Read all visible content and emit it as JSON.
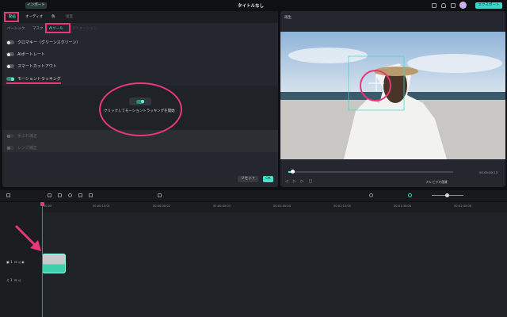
{
  "topbar": {
    "import": "インポート",
    "title": "タイトルなし",
    "export": "エクスポート"
  },
  "tabs": [
    "動画",
    "オーディオ",
    "色",
    "速度"
  ],
  "subtabs": [
    "ベーシック",
    "マスク",
    "AIツール",
    "アニメーション"
  ],
  "tools": [
    {
      "label": "クロマキー（グリーンスクリーン）",
      "on": false
    },
    {
      "label": "AIポートレート",
      "on": false
    },
    {
      "label": "スマートカットアウト",
      "on": false
    },
    {
      "label": "モーショントラッキング",
      "on": true
    }
  ],
  "motion_tracking": {
    "start_label": "クリックしてモーショントラッキングを開始"
  },
  "disabled": [
    "手ぶれ補正",
    "レンズ補正"
  ],
  "buttons": {
    "reset": "リセット",
    "ok": "OK"
  },
  "preview": {
    "label": "再生",
    "timecode": "00:00:00:13",
    "quality": "フル ビデオ画質",
    "progress": 0.04
  },
  "ruler": [
    "00:00",
    "00:00:15:01",
    "00:00:30:02",
    "00:00:45:03",
    "00:01:00:04",
    "00:01:15:05",
    "00:01:30:06",
    "00:01:45:08"
  ],
  "tracks": {
    "video": "1",
    "audio": "1"
  },
  "accent": "#3ad6c8",
  "annotation": "#e8387a"
}
